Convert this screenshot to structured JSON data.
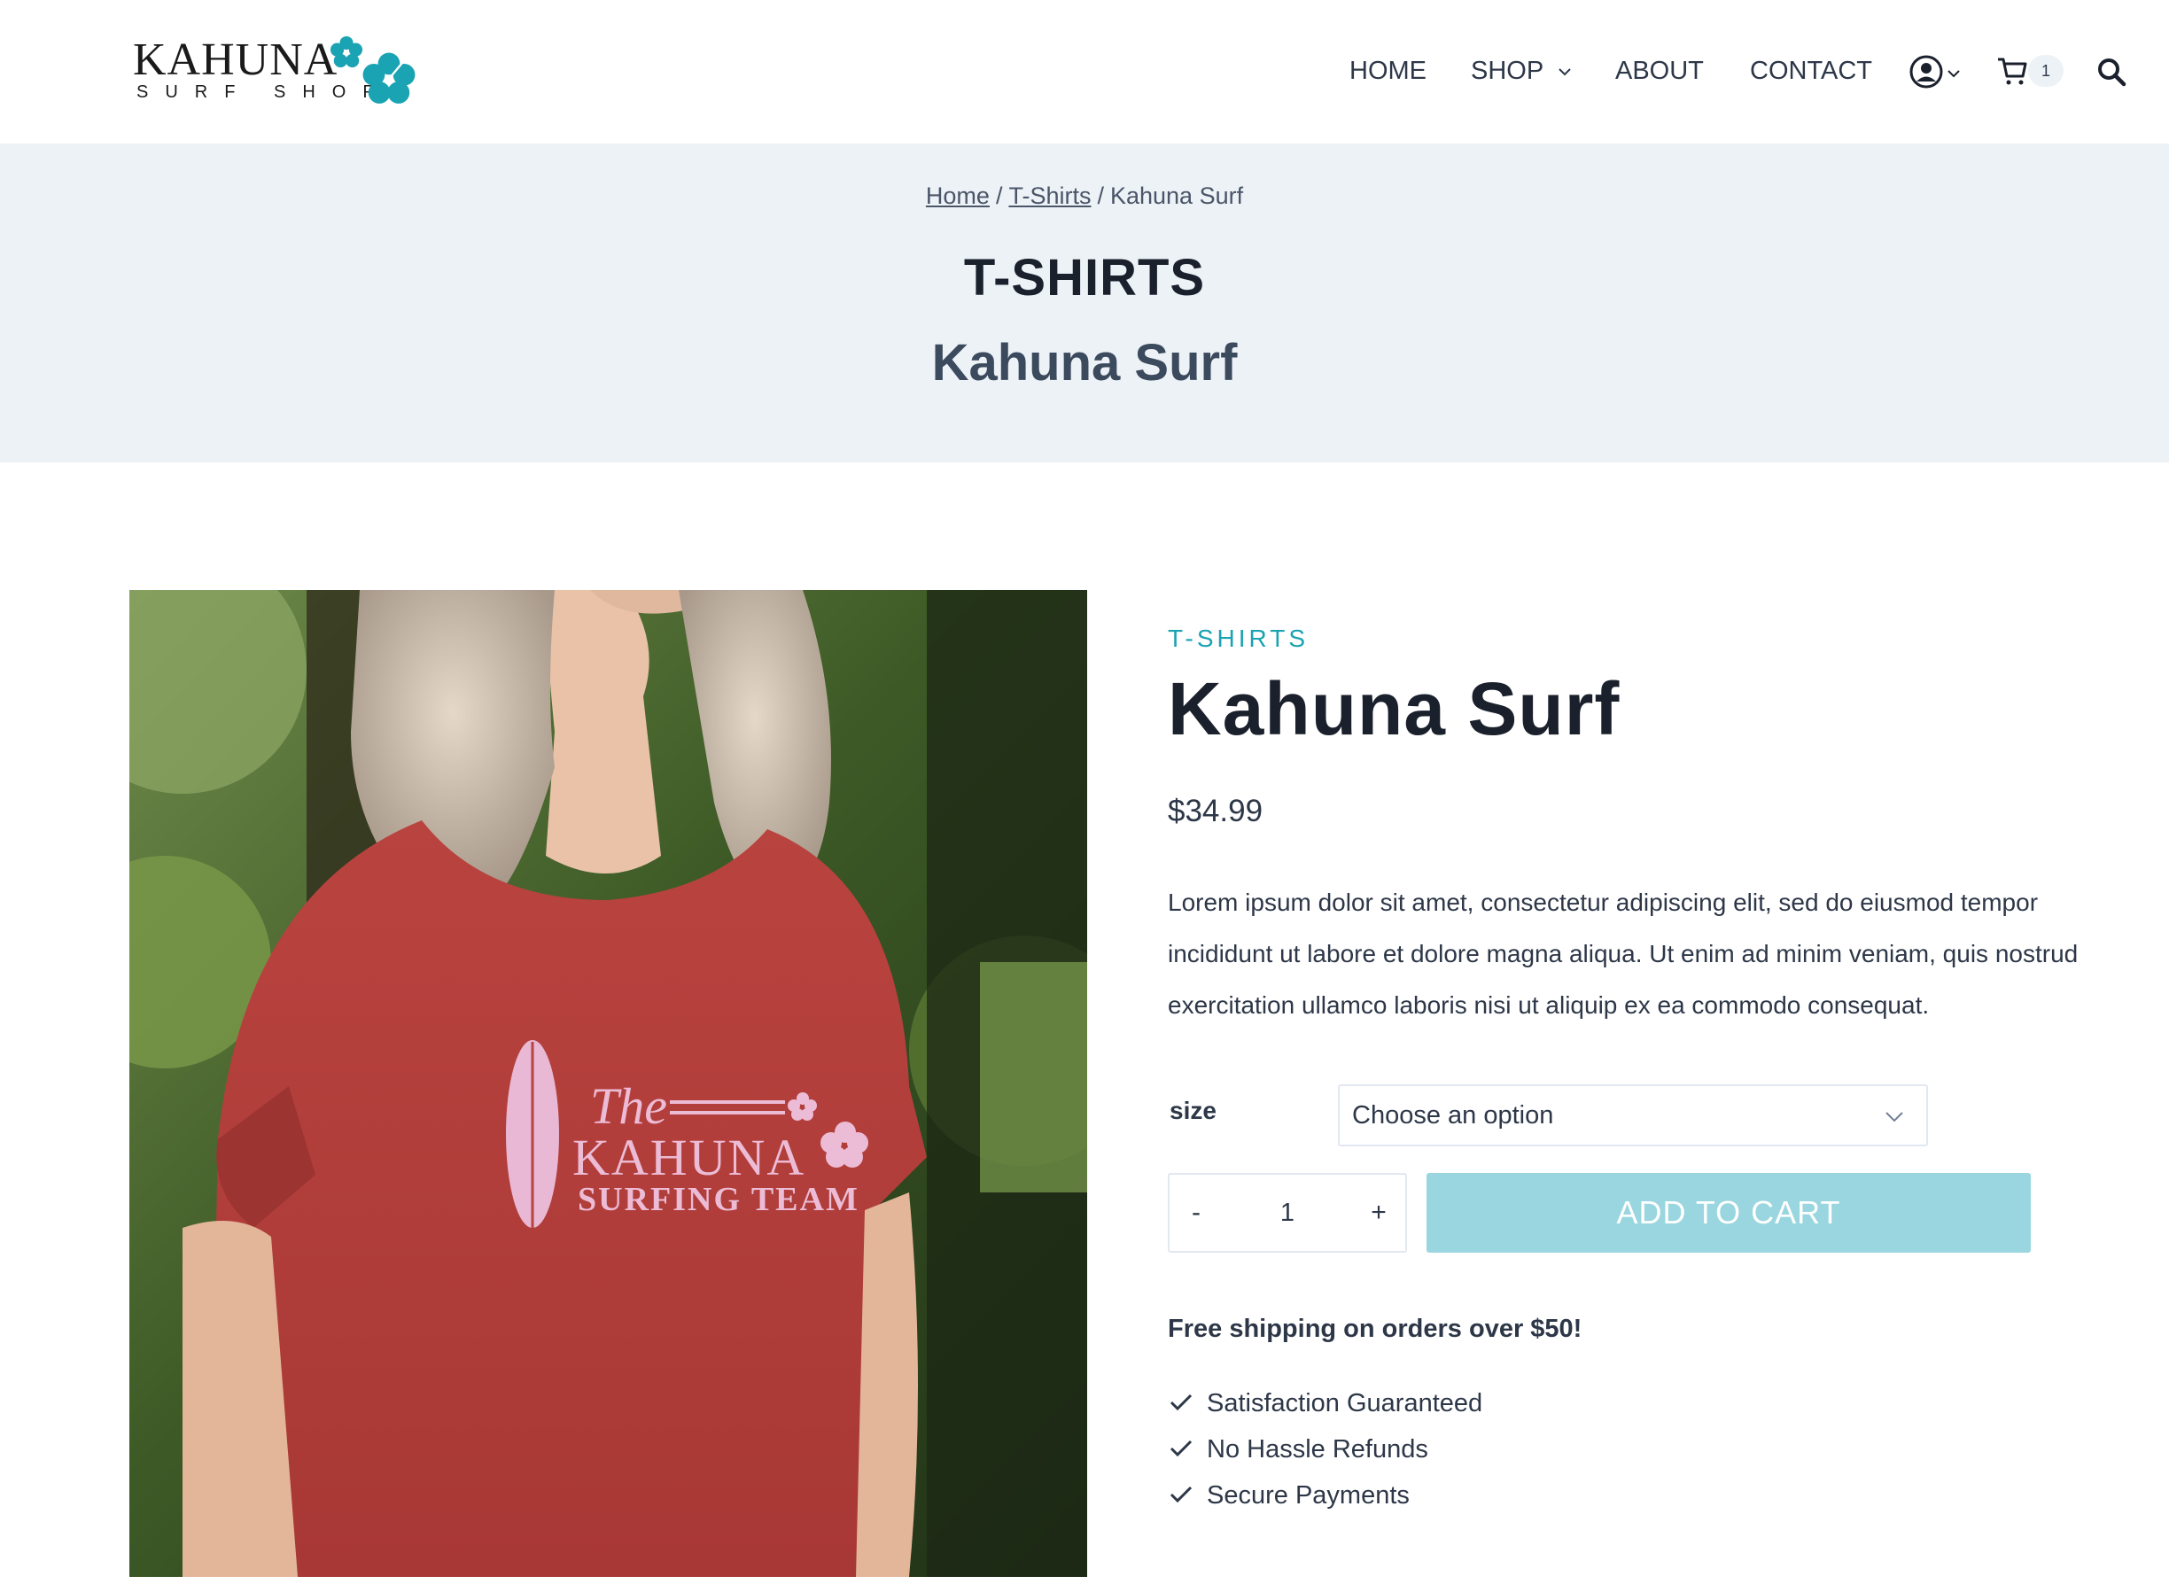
{
  "header": {
    "logo": {
      "word": "KAHUNA",
      "sub": "SURF SHOP"
    },
    "nav": [
      {
        "label": "HOME"
      },
      {
        "label": "SHOP"
      },
      {
        "label": "ABOUT"
      },
      {
        "label": "CONTACT"
      }
    ],
    "cart_count": "1",
    "icons": [
      "user-icon",
      "chevron-down-icon",
      "cart-icon",
      "search-icon"
    ]
  },
  "breadcrumb": {
    "home": "Home",
    "category": "T-Shirts",
    "current": "Kahuna Surf",
    "separator": "/"
  },
  "title_band": {
    "category": "T-SHIRTS",
    "title": "Kahuna Surf"
  },
  "product": {
    "category": "T-SHIRTS",
    "title": "Kahuna Surf",
    "price": "$34.99",
    "description": "Lorem ipsum dolor sit amet, consectetur adipiscing elit, sed do eiusmod tempor incididunt ut labore et dolore magna aliqua. Ut enim ad minim veniam, quis nostrud exercitation ullamco laboris nisi ut aliquip ex ea commodo consequat.",
    "image_print": {
      "line1": "The",
      "line2": "KAHUNA",
      "line3": "SURFING TEAM"
    },
    "size_label": "size",
    "size_placeholder": "Choose an option",
    "quantity": "1",
    "qty_minus": "-",
    "qty_plus": "+",
    "add_to_cart": "ADD TO CART",
    "shipping_note": "Free shipping on orders over $50!",
    "features": [
      "Satisfaction Guaranteed",
      "No Hassle Refunds",
      "Secure Payments"
    ]
  },
  "colors": {
    "accent": "#1aa3b2",
    "button": "#9ad6df",
    "band": "#edf2f7",
    "text": "#2d3748",
    "heading": "#1a202c",
    "shirt": "#b5403e"
  }
}
